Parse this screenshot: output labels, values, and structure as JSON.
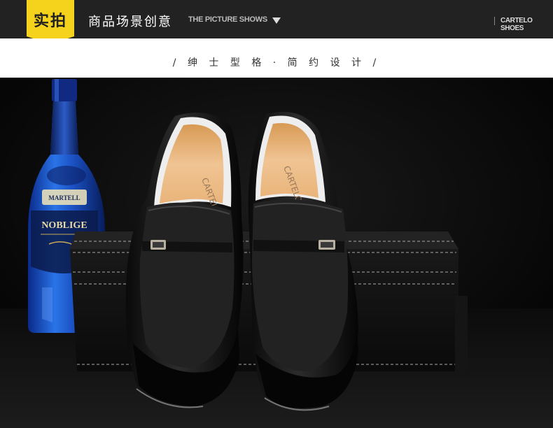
{
  "header": {
    "badge": "实拍",
    "title": "商品场景创意",
    "subtitle": "THE PICTURE SHOWS",
    "brand": "CARTELO SHOES"
  },
  "band": {
    "tagline": "/ 绅 士 型 格 · 简 约 设 计 /"
  },
  "photo": {
    "bottle_label_top": "MARTELL",
    "bottle_label_main": "NOBLIGE",
    "insole_brand": "CARTELO"
  },
  "colors": {
    "accent": "#f5d21b",
    "header_bg": "#222222"
  }
}
